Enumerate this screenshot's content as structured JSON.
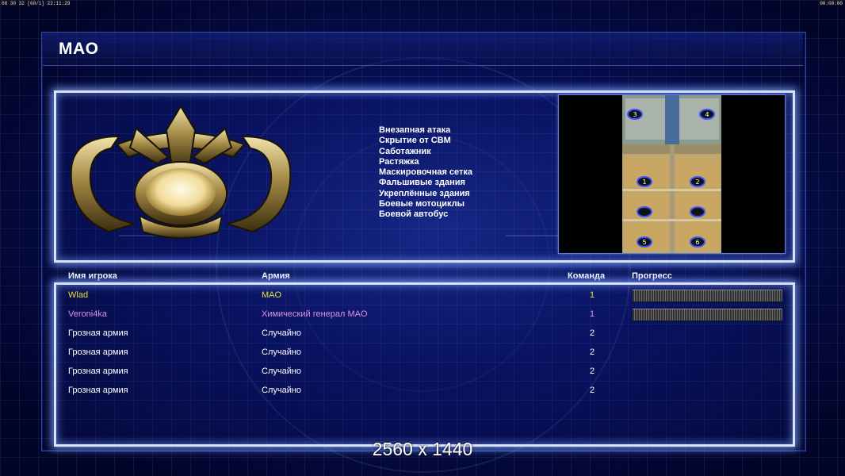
{
  "status_bar": {
    "left": "08 30 32 [60/1] 22:11:29",
    "right": "00:00:00"
  },
  "title": "MAO",
  "general": {
    "emblem": "mao-general-emblem"
  },
  "modifiers": [
    "Внезапная атака",
    "Скрытие от СВМ",
    "Саботажник",
    "Растяжка",
    "Маскировочная сетка",
    "Фальшивые здания",
    "Укреплённые здания",
    "Боевые мотоциклы",
    "Боевой автобус"
  ],
  "minimap": {
    "start_positions": [
      "1",
      "2",
      "3",
      "4",
      "5",
      "6"
    ]
  },
  "columns": {
    "name": "Имя игрока",
    "army": "Армия",
    "team": "Команда",
    "progress": "Прогресс"
  },
  "players": [
    {
      "name": "Wlad",
      "army": "MAO",
      "team": "1",
      "color": "#e6e23a",
      "progress": 1.0
    },
    {
      "name": "Veroni4ka",
      "army": "Химический генерал MAO",
      "team": "1",
      "color": "#e090e0",
      "progress": 1.0
    },
    {
      "name": "Грозная армия",
      "army": "Случайно",
      "team": "2",
      "color": "#ffffff"
    },
    {
      "name": "Грозная армия",
      "army": "Случайно",
      "team": "2",
      "color": "#ffffff"
    },
    {
      "name": "Грозная армия",
      "army": "Случайно",
      "team": "2",
      "color": "#ffffff"
    },
    {
      "name": "Грозная армия",
      "army": "Случайно",
      "team": "2",
      "color": "#ffffff"
    }
  ],
  "resolution_label": "2560 x 1440"
}
